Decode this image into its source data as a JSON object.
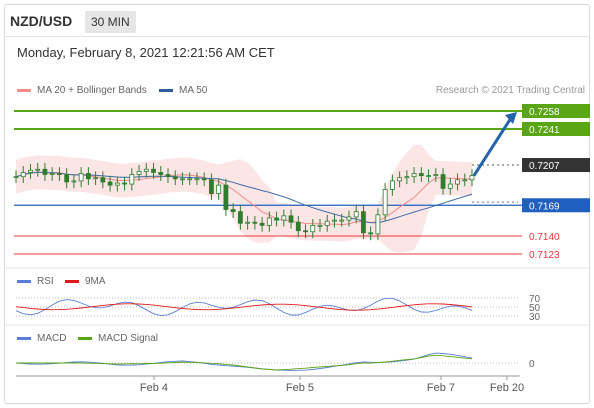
{
  "header": {
    "pair": "NZD/USD",
    "timeframe": "30 MIN",
    "datetime": "Monday, February 8, 2021 12:21:56 AM CET"
  },
  "legend": {
    "bb": "MA 20 + Bollinger Bands",
    "ma50": "MA 50",
    "copyright": "Research © 2021 Trading Central",
    "rsi": "RSI",
    "rsi9": "9MA",
    "macd": "MACD",
    "macd_signal": "MACD Signal"
  },
  "colors": {
    "green": "#5aa514",
    "blue": "#1f5fbf",
    "red": "#e8383d",
    "bb_fill": "#fbdcdc",
    "ma20": "#f08a8a",
    "ma50": "#3f6aa8",
    "candle": "#2f7d2f",
    "current": "#333333",
    "arrow": "#2563a8"
  },
  "chart_data": [
    {
      "type": "candlestick",
      "title": "NZD/USD 30 MIN",
      "x_tick_labels": [
        "Feb 4",
        "Feb 5",
        "Feb 7",
        "Feb 20"
      ],
      "levels": [
        {
          "value": 0.7258,
          "label": "0.7258",
          "kind": "resistance"
        },
        {
          "value": 0.7241,
          "label": "0.7241",
          "kind": "resistance"
        },
        {
          "value": 0.7207,
          "label": "0.7207",
          "kind": "current"
        },
        {
          "value": 0.7169,
          "label": "0.7169",
          "kind": "pivot"
        },
        {
          "value": 0.714,
          "label": "0.7140",
          "kind": "support"
        },
        {
          "value": 0.7123,
          "label": "0.7123",
          "kind": "support"
        }
      ],
      "close_series": [
        0.7196,
        0.72,
        0.7202,
        0.7203,
        0.7198,
        0.7199,
        0.7198,
        0.7191,
        0.7192,
        0.7199,
        0.7194,
        0.7195,
        0.7191,
        0.7188,
        0.719,
        0.7189,
        0.7198,
        0.7201,
        0.7203,
        0.72,
        0.7198,
        0.7196,
        0.7194,
        0.7194,
        0.7194,
        0.7194,
        0.7193,
        0.718,
        0.7188,
        0.7165,
        0.7163,
        0.7152,
        0.7153,
        0.7152,
        0.715,
        0.7157,
        0.7155,
        0.7159,
        0.7153,
        0.7145,
        0.7144,
        0.715,
        0.715,
        0.7154,
        0.7155,
        0.7155,
        0.7158,
        0.7163,
        0.7143,
        0.7142,
        0.716,
        0.7184,
        0.7192,
        0.7195,
        0.7196,
        0.7199,
        0.7197,
        0.7197,
        0.7198,
        0.7185,
        0.7189,
        0.7193,
        0.7193,
        0.7197
      ],
      "forecast_to": 0.7258
    },
    {
      "type": "line",
      "title": "RSI",
      "series": [
        {
          "name": "RSI"
        },
        {
          "name": "9MA"
        }
      ],
      "tick_labels": [
        "70",
        "50",
        "30"
      ]
    },
    {
      "type": "line",
      "title": "MACD",
      "series": [
        {
          "name": "MACD"
        },
        {
          "name": "MACD Signal"
        }
      ],
      "tick_labels": [
        "0"
      ]
    }
  ]
}
